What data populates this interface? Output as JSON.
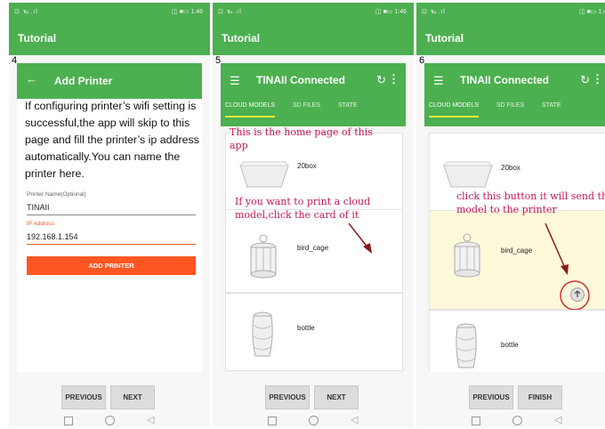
{
  "status": {
    "left": "⊡ ℡.ıl",
    "right": "◫ ■▭ 1:46"
  },
  "nav_icons": {
    "square": "square-nav-icon",
    "circle": "circle-nav-icon",
    "triangle": "back-triangle-nav-icon",
    "triangle_glyph": "◁"
  },
  "colors": {
    "green": "#4caf50",
    "orange": "#ff5722",
    "note": "#c2185b",
    "highlight": "#fff9dc"
  },
  "panels": [
    {
      "appbar_title": "Tutorial",
      "step": "4",
      "back_glyph": "←",
      "page_title": "Add Printer",
      "info_text": "If configuring printer’s wifi setting is successful,the app will skip to this page and fill the printer’s ip address automatically.You can name the printer here.",
      "name_label": "Printer Name(Optional)",
      "name_value": "TINAII",
      "ip_label": "IP Address",
      "ip_value": "192.168.1.154",
      "add_button": "ADD PRINTER",
      "prev": "PREVIOUS",
      "next": "NEXT"
    },
    {
      "appbar_title": "Tutorial",
      "step": "5",
      "menu_glyph": "☰",
      "title": "TINAII Connected",
      "refresh_glyph": "↻",
      "more_glyph": "⋮",
      "tabs": [
        "CLOUD MODELS",
        "SD FILES",
        "STATE"
      ],
      "models": [
        "20box",
        "bird_cage",
        "bottle"
      ],
      "note1": "This is the home page of this app",
      "note2": "If you want to print a cloud model,click the card of it",
      "prev": "PREVIOUS",
      "next": "NEXT"
    },
    {
      "appbar_title": "Tutorial",
      "step": "6",
      "menu_glyph": "☰",
      "title": "TINAII Connected",
      "refresh_glyph": "↻",
      "more_glyph": "⋮",
      "tabs": [
        "CLOUD MODELS",
        "SD FILES",
        "STATE"
      ],
      "models": [
        "20box",
        "bird_cage",
        "bottle"
      ],
      "note": "click this button it will send the model to the printer",
      "prev": "PREVIOUS",
      "finish": "FINISH"
    }
  ]
}
